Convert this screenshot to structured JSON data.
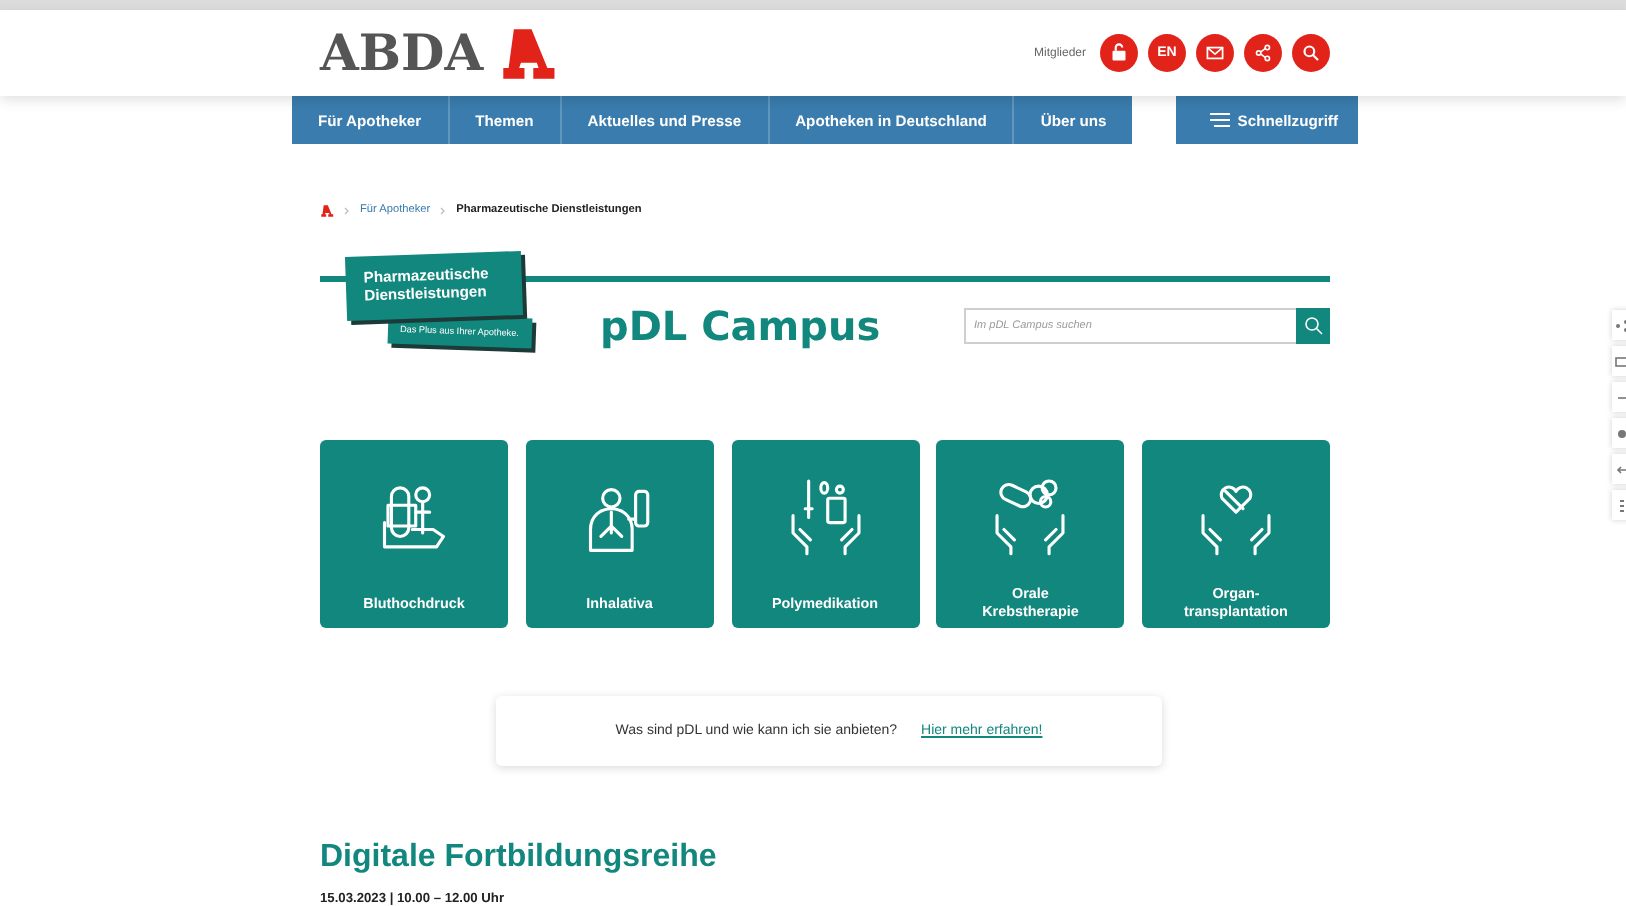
{
  "header": {
    "logo": "ABDA",
    "member_label": "Mitglieder",
    "icons": [
      {
        "kind": "lock"
      },
      {
        "kind": "lang",
        "label": "EN"
      },
      {
        "kind": "mail"
      },
      {
        "kind": "share"
      },
      {
        "kind": "search"
      }
    ]
  },
  "nav": {
    "items": [
      "Für Apotheker",
      "Themen",
      "Aktuelles und Presse",
      "Apotheken in Deutschland",
      "Über uns"
    ],
    "quick_access": "Schnellzugriff"
  },
  "breadcrumb": [
    {
      "label": "Für Apotheker",
      "current": false
    },
    {
      "label": "Pharmazeutische Dienstleistungen",
      "current": true
    }
  ],
  "campus": {
    "badge_title": "Pharmazeutische Dienstleistungen",
    "badge_tagline": "Das Plus aus Ihrer Apotheke.",
    "title": "pDL Campus",
    "search": {
      "placeholder": "Im pDL Campus suchen"
    }
  },
  "topics": [
    {
      "kind": "blood-pressure",
      "label": "Bluthochdruck"
    },
    {
      "kind": "inhaler",
      "label": "Inhalativa"
    },
    {
      "kind": "medication",
      "label": "Polymedikation"
    },
    {
      "kind": "cancer",
      "label": "Orale Krebstherapie"
    },
    {
      "kind": "transplant",
      "label": "Organ-transplantation"
    }
  ],
  "info": {
    "question": "Was sind pDL und wie kann ich sie anbieten?",
    "link": "Hier mehr erfahren!"
  },
  "event": {
    "heading": "Digitale Fortbildungsreihe",
    "date": "15.03.2023 | 10.00 – 12.00 Uhr"
  },
  "side_tools": [
    {
      "kind": "share"
    },
    {
      "kind": "mail"
    },
    {
      "kind": "minus"
    },
    {
      "kind": "dot"
    },
    {
      "kind": "back"
    },
    {
      "kind": "list"
    }
  ]
}
